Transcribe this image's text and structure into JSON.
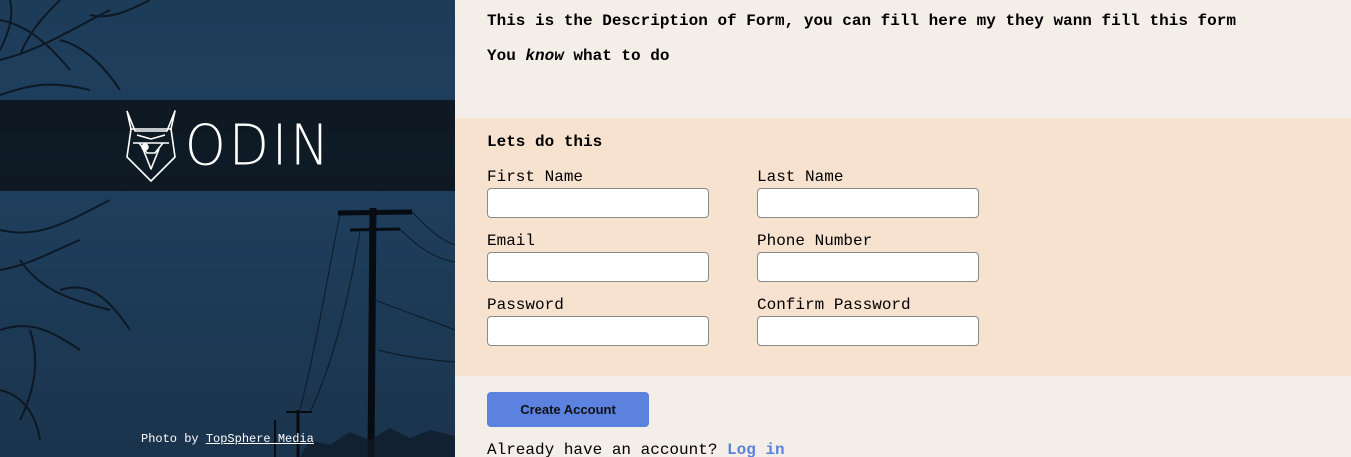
{
  "brand": {
    "logo_text": "ODIN",
    "logo_icon": "viking-helmet-icon"
  },
  "photo_credit": {
    "prefix": "Photo by ",
    "link": "TopSphere Media"
  },
  "description": {
    "line1": "This is the Description of Form, you can fill here my they wann fill this form",
    "line2_before": "You ",
    "line2_em": "know",
    "line2_after": " what to do"
  },
  "form": {
    "title": "Lets do this",
    "fields": {
      "first_name": "First Name",
      "last_name": "Last Name",
      "email": "Email",
      "phone": "Phone Number",
      "password": "Password",
      "confirm_password": "Confirm Password"
    }
  },
  "actions": {
    "create_account": "Create Account",
    "login_prompt": "Already have an account? ",
    "login_link": "Log in"
  },
  "colors": {
    "accent": "#5b82de",
    "form_bg": "#f7e1cf",
    "page_bg": "#f3eee8",
    "sidebar_bg": "#1d3c58"
  }
}
